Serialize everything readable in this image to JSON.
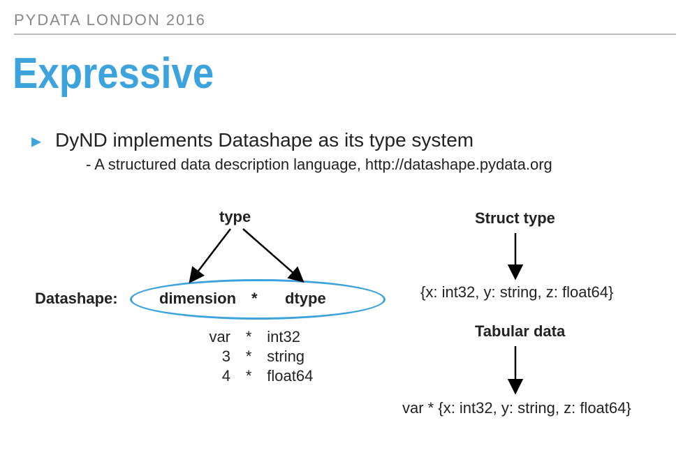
{
  "header": "PYDATA LONDON 2016",
  "title": "Expressive",
  "bullet": {
    "main": "DyND implements Datashape as its type system",
    "sub": "- A structured data description language, http://datashape.pydata.org"
  },
  "diagram": {
    "type_label": "type",
    "datashape_label": "Datashape:",
    "dimension_label": "dimension",
    "star_label": "*",
    "dtype_label": "dtype",
    "rows": [
      {
        "dimension": "var",
        "star": "*",
        "dtype": "int32"
      },
      {
        "dimension": "3",
        "star": "*",
        "dtype": "string"
      },
      {
        "dimension": "4",
        "star": "*",
        "dtype": "float64"
      }
    ]
  },
  "right": {
    "struct_label": "Struct type",
    "struct_example": "{x: int32, y: string, z: float64}",
    "tabular_label": "Tabular data",
    "tabular_example": "var * {x: int32, y: string, z: float64}"
  }
}
